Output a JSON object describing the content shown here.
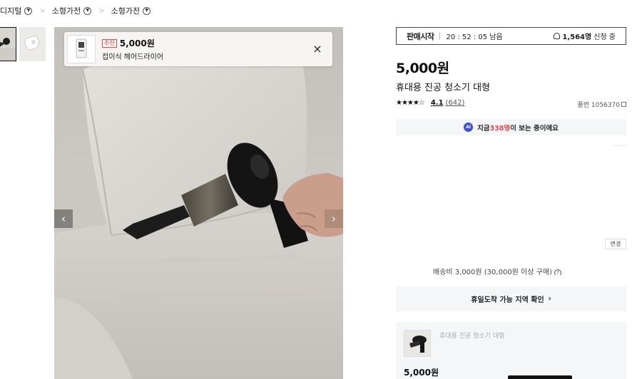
{
  "breadcrumb": {
    "items": [
      {
        "label": "디지털"
      },
      {
        "label": "소형가전"
      },
      {
        "label": "소형가전"
      }
    ],
    "separator": ">"
  },
  "gallery": {
    "thumbnails": [
      "thumb-vacuum-sofa",
      "thumb-vacuum-white"
    ],
    "prev_icon": "‹",
    "next_icon": "›"
  },
  "recommendation": {
    "badge": "추천",
    "price": "5,000원",
    "name": "접이식 헤어드라이어",
    "close_icon": "×"
  },
  "sale": {
    "label": "판매시작",
    "countdown": "20 : 52 : 05 남음",
    "count": "1,564명",
    "count_suffix": "신청 중"
  },
  "product": {
    "price": "5,000원",
    "title": "휴대용 진공 청소기 대형",
    "stars": "★★★★☆",
    "rating_score": "4.1",
    "rating_count": "(642)",
    "sku": "품번 1056370"
  },
  "viewers": {
    "ai_label": "AI",
    "prefix": "지금 ",
    "highlight": "338명",
    "suffix": "이 보는 중이에요"
  },
  "delivery": {
    "change_label": "변경",
    "shipping_text": "배송비 3,000원 (30,000원 이상 구매)",
    "arrival_label": "휴일도착 가능 지역 확인",
    "arrival_chevron": "›"
  },
  "mini_card": {
    "name": "휴대용 진공 청소기 대형",
    "price": "5,000원"
  },
  "colors": {
    "accent_red": "#e5484d",
    "ai_blue": "#3b4fd8",
    "panel_gray": "#f5f6f8"
  }
}
